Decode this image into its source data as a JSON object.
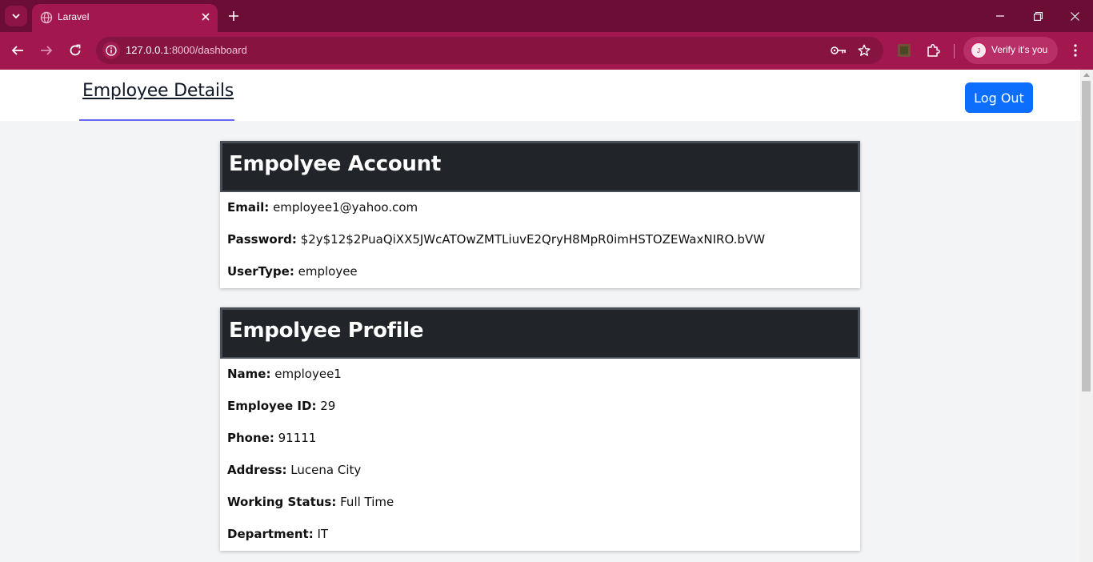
{
  "browser": {
    "tab_title": "Laravel",
    "url_host": "127.0.0.1",
    "url_rest": ":8000/dashboard",
    "profile_initial": "J",
    "profile_label": "Verify it's you"
  },
  "nav": {
    "brand": "Employee Details",
    "logout_label": "Log Out"
  },
  "account": {
    "title": "Empolyee Account",
    "fields": [
      {
        "label": "Email:",
        "value": "employee1@yahoo.com"
      },
      {
        "label": "Password:",
        "value": "$2y$12$2PuaQiXX5JWcATOwZMTLiuvE2QryH8MpR0imHSTOZEWaxNIRO.bVW"
      },
      {
        "label": "UserType:",
        "value": "employee"
      }
    ]
  },
  "profile": {
    "title": "Empolyee Profile",
    "fields": [
      {
        "label": "Name:",
        "value": "employee1"
      },
      {
        "label": "Employee ID:",
        "value": "29"
      },
      {
        "label": "Phone:",
        "value": "91111"
      },
      {
        "label": "Address:",
        "value": "Lucena City"
      },
      {
        "label": "Working Status:",
        "value": "Full Time"
      },
      {
        "label": "Department:",
        "value": "IT"
      }
    ]
  },
  "colors": {
    "chrome_tabbar": "#6b0d35",
    "chrome_toolbar": "#a3174f",
    "card_header": "#212529",
    "logout_button": "#0d6efd",
    "brand_underline": "#6366f1"
  }
}
